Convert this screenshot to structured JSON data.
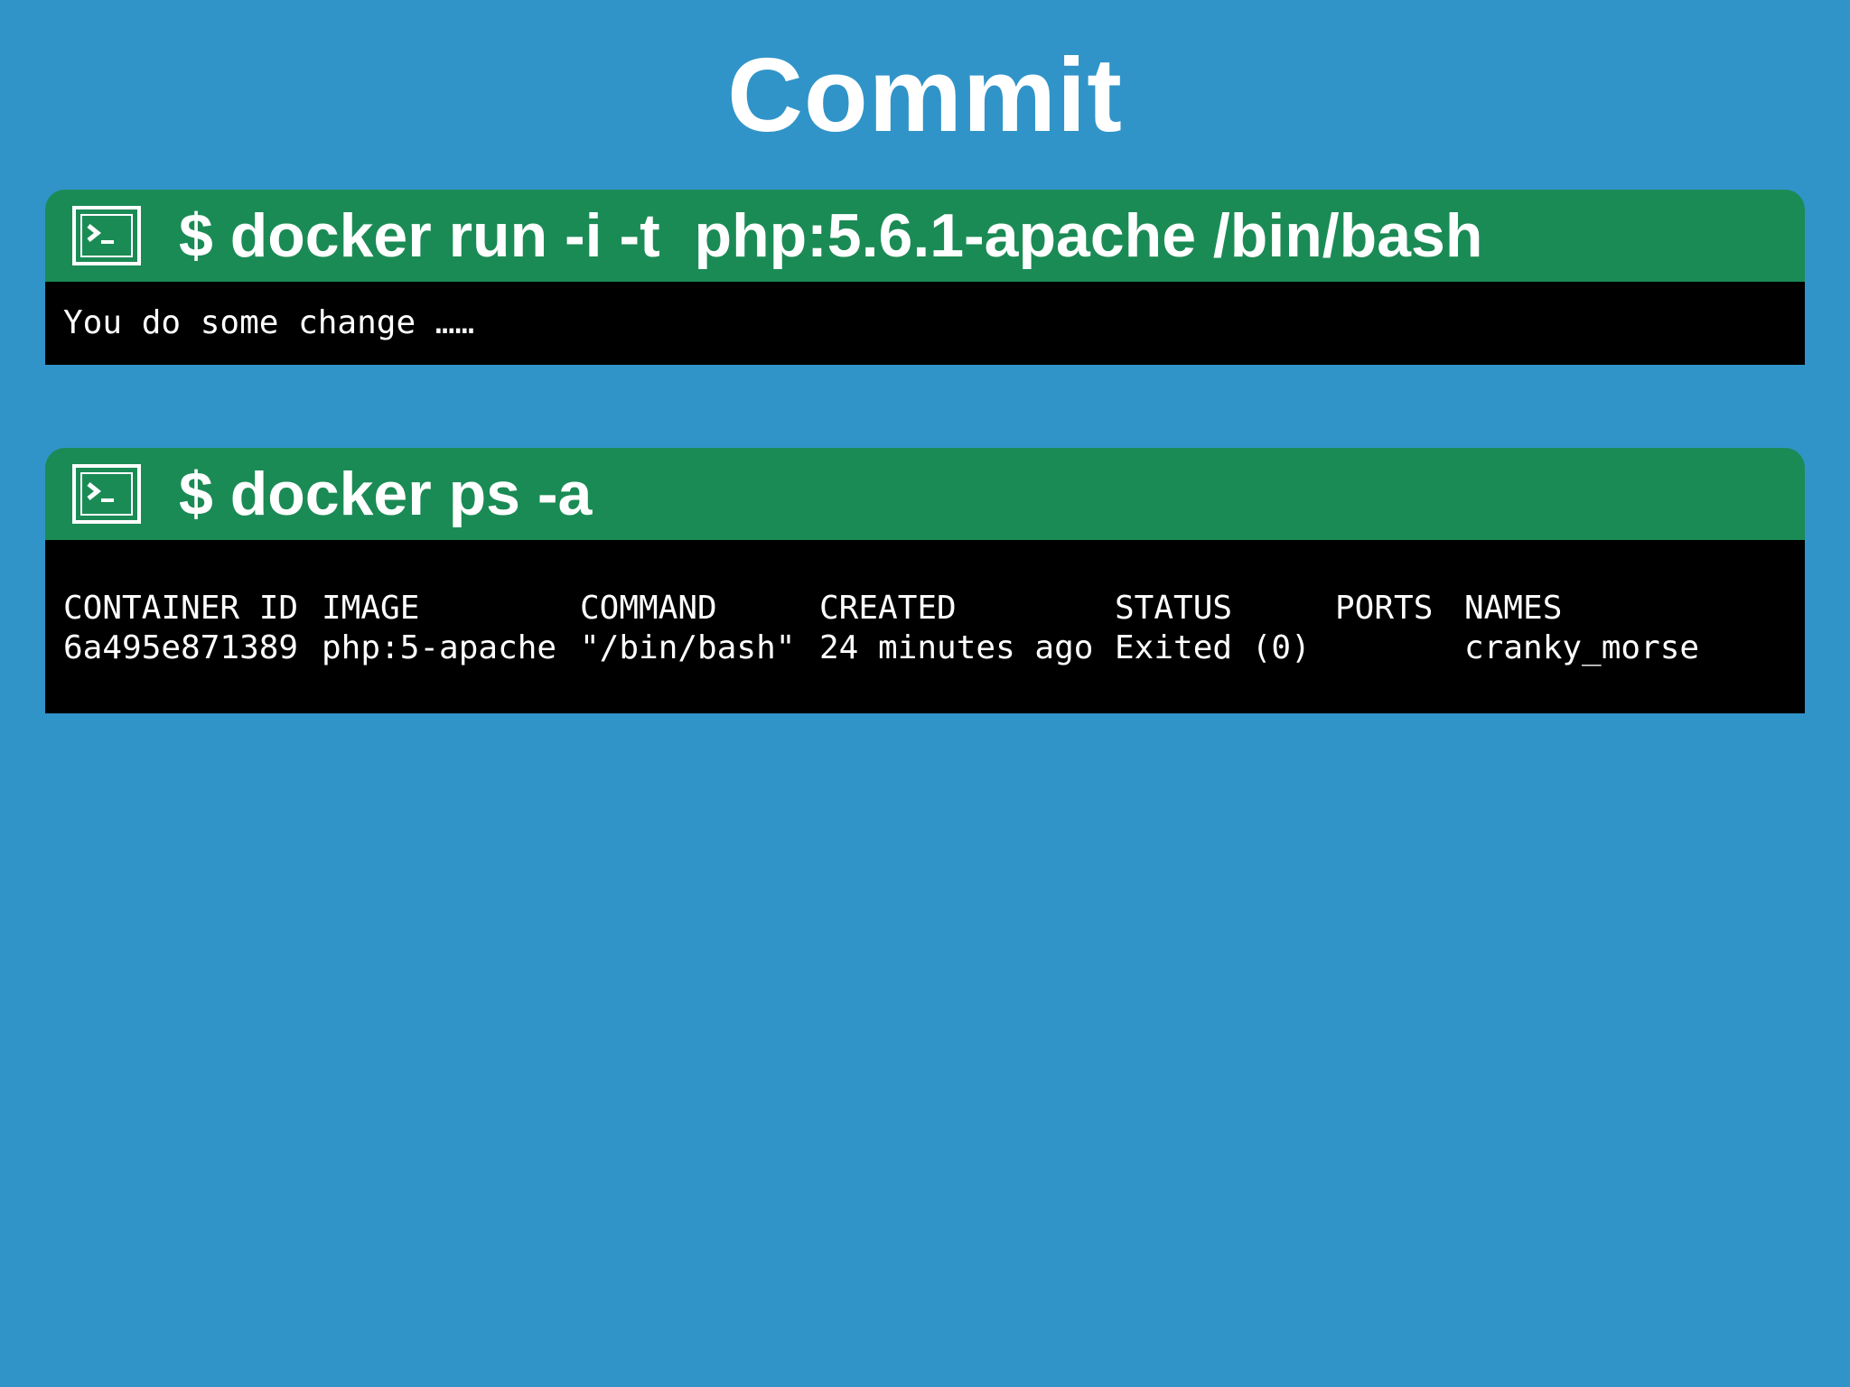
{
  "title": "Commit",
  "colors": {
    "background": "#3094c8",
    "command_bar": "#1b8b55",
    "terminal": "#000000",
    "text": "#ffffff"
  },
  "blocks": [
    {
      "icon": "terminal-icon",
      "command": "$ docker run -i -t  php:5.6.1-apache /bin/bash",
      "output": "You do some change ……"
    },
    {
      "icon": "terminal-icon",
      "command": "$ docker ps -a",
      "table": {
        "headers": [
          "CONTAINER ID",
          "IMAGE",
          "COMMAND",
          "CREATED",
          "STATUS",
          "PORTS",
          "NAMES"
        ],
        "rows": [
          [
            "6a495e871389",
            "php:5-apache",
            "\"/bin/bash\"",
            "24 minutes ago",
            "Exited (0)",
            "",
            "cranky_morse"
          ]
        ]
      }
    }
  ]
}
